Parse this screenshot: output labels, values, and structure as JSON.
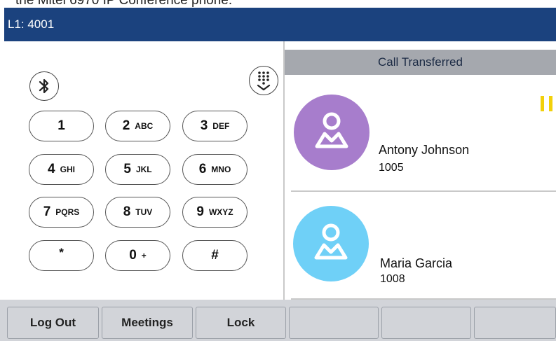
{
  "caption": "the Mitel 6970 IP Conference phone.",
  "header": {
    "line_label": "L1: 4001"
  },
  "keypad": {
    "bluetooth_icon": "bluetooth-icon",
    "dialpad_toggle_icon": "dialpad-collapse-icon",
    "keys": [
      {
        "digit": "1",
        "letters": ""
      },
      {
        "digit": "2",
        "letters": "ABC"
      },
      {
        "digit": "3",
        "letters": "DEF"
      },
      {
        "digit": "4",
        "letters": "GHI"
      },
      {
        "digit": "5",
        "letters": "JKL"
      },
      {
        "digit": "6",
        "letters": "MNO"
      },
      {
        "digit": "7",
        "letters": "PQRS"
      },
      {
        "digit": "8",
        "letters": "TUV"
      },
      {
        "digit": "9",
        "letters": "WXYZ"
      },
      {
        "digit": "*",
        "letters": ""
      },
      {
        "digit": "0",
        "letters": "+"
      },
      {
        "digit": "#",
        "letters": ""
      }
    ]
  },
  "call_panel": {
    "status": "Call Transferred",
    "calls": [
      {
        "name": "Antony Johnson",
        "number": "1005",
        "avatar_color": "#a77dcc",
        "state_icon": "hold-pause-icon"
      },
      {
        "name": "Maria Garcia",
        "number": "1008",
        "avatar_color": "#6fd0f7"
      }
    ],
    "hold_color": "#f2d10b"
  },
  "softkeys": [
    "Log Out",
    "Meetings",
    "Lock",
    "",
    "",
    ""
  ],
  "colors": {
    "header": "#1b427e",
    "status_bar": "#a5a8ae",
    "softkey_bar": "#d2d4d9"
  }
}
